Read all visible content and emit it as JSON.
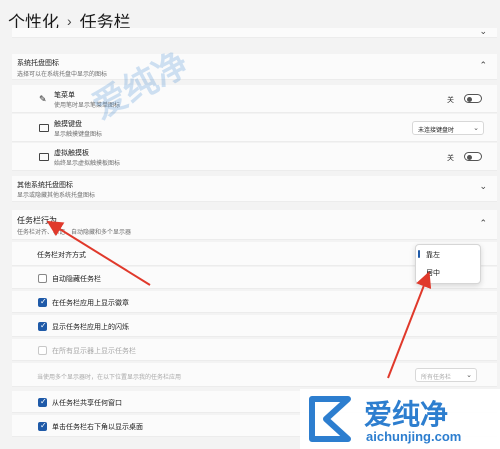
{
  "breadcrumb": {
    "parent": "个性化",
    "separator": "›",
    "current": "任务栏"
  },
  "tray_icons": {
    "title": "系统托盘图标",
    "subtitle": "选择可以在系统托盘中显示的图标",
    "items": [
      {
        "label": "笔菜单",
        "desc": "使用笔时显示笔菜单图标",
        "control": "toggle",
        "state": "关",
        "icon": "pen-icon"
      },
      {
        "label": "触摸键盘",
        "desc": "显示触摸键盘图标",
        "control": "dropdown",
        "value": "未连接键盘时",
        "icon": "keyboard-icon"
      },
      {
        "label": "虚拟触摸板",
        "desc": "始终显示虚拟触摸板图标",
        "control": "toggle",
        "state": "关",
        "icon": "touchpad-icon"
      }
    ]
  },
  "other_tray": {
    "title": "其他系统托盘图标",
    "subtitle": "显示或隐藏其他系统托盘图标"
  },
  "behavior": {
    "title": "任务栏行为",
    "subtitle": "任务栏对齐、标记、自动隐藏和多个显示器",
    "alignment_label": "任务栏对齐方式",
    "alignment_options": [
      "靠左",
      "居中"
    ],
    "checkboxes": [
      {
        "label": "自动隐藏任务栏",
        "checked": false,
        "disabled": false
      },
      {
        "label": "在任务栏应用上显示徽章",
        "checked": true,
        "disabled": false
      },
      {
        "label": "显示任务栏应用上的闪烁",
        "checked": true,
        "disabled": false
      },
      {
        "label": "在所有显示器上显示任务栏",
        "checked": false,
        "disabled": true
      }
    ],
    "multi_display_label": "当使用多个显示器时，在以下位置显示我的任务栏应用",
    "multi_display_value": "所有任务栏",
    "bottom_checkboxes": [
      {
        "label": "从任务栏共享任何窗口",
        "checked": true
      },
      {
        "label": "单击任务栏右下角以显示桌面",
        "checked": true
      }
    ]
  },
  "colors": {
    "accent": "#1f5aa8",
    "arrow": "#e0392b",
    "watermark": "#2d7ecf"
  },
  "watermark": {
    "brand": "爱纯净",
    "url": "aichunjing.com"
  }
}
